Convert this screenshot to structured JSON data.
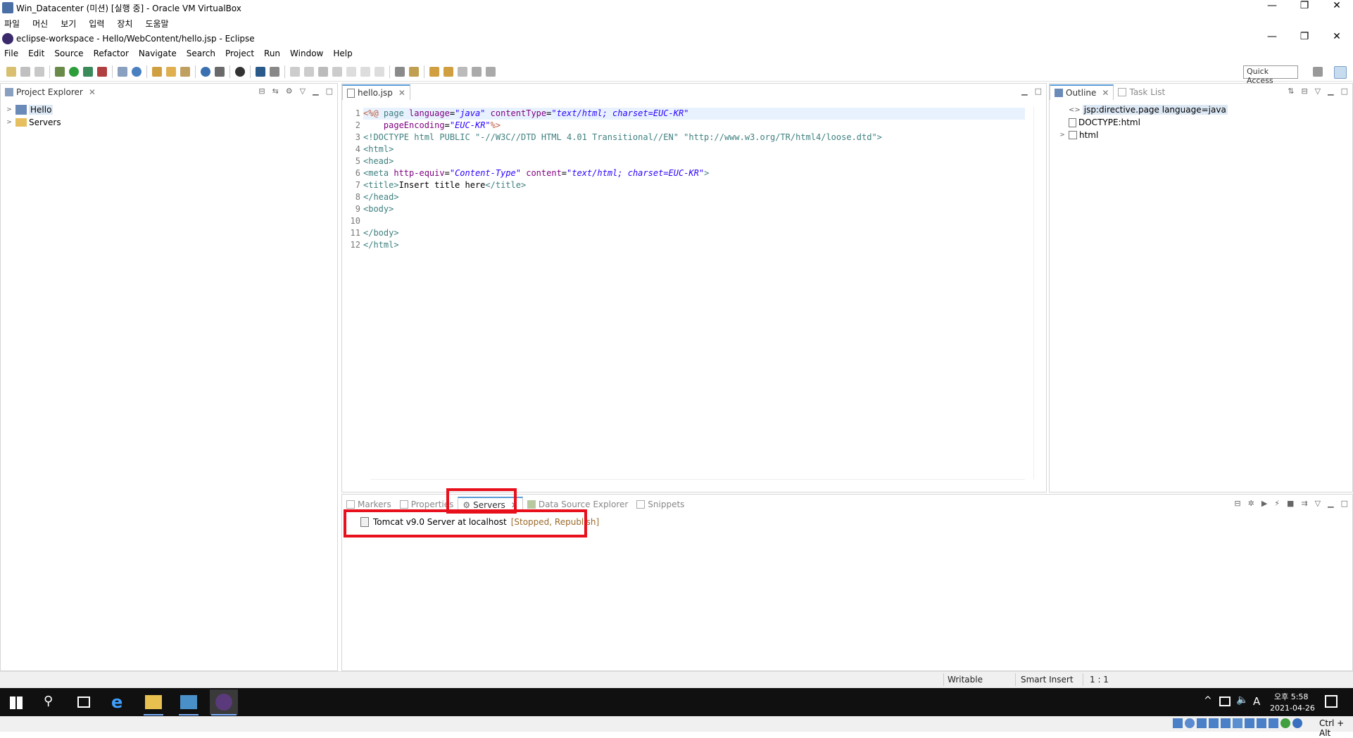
{
  "vbox": {
    "title": "Win_Datacenter (미션) [실행 중] - Oracle VM VirtualBox",
    "menu": [
      "파일",
      "머신",
      "보기",
      "입력",
      "장치",
      "도움말"
    ],
    "hostkey": "Ctrl + Alt"
  },
  "eclipse": {
    "title": "eclipse-workspace - Hello/WebContent/hello.jsp - Eclipse",
    "menu": [
      "File",
      "Edit",
      "Source",
      "Refactor",
      "Navigate",
      "Search",
      "Project",
      "Run",
      "Window",
      "Help"
    ],
    "quick_access": "Quick Access"
  },
  "project_explorer": {
    "tab": "Project Explorer",
    "items": [
      "Hello",
      "Servers"
    ]
  },
  "editor": {
    "tab": "hello.jsp",
    "line_numbers": [
      "1",
      "2",
      "3",
      "4",
      "5",
      "6",
      "7",
      "8",
      "9",
      "10",
      "11",
      "12"
    ]
  },
  "outline": {
    "tab": "Outline",
    "tab2": "Task List",
    "items": [
      "jsp:directive.page language=java",
      "DOCTYPE:html",
      "html"
    ]
  },
  "servers_panel": {
    "tabs": [
      "Markers",
      "Properties",
      "Servers",
      "Data Source Explorer",
      "Snippets"
    ],
    "server_name": "Tomcat v9.0 Server at localhost",
    "server_state": "[Stopped, Republish]"
  },
  "status": {
    "writable": "Writable",
    "insert_mode": "Smart Insert",
    "position": "1 : 1"
  },
  "taskbar": {
    "time": "오후 5:58",
    "date": "2021-04-26",
    "ime": "A"
  }
}
